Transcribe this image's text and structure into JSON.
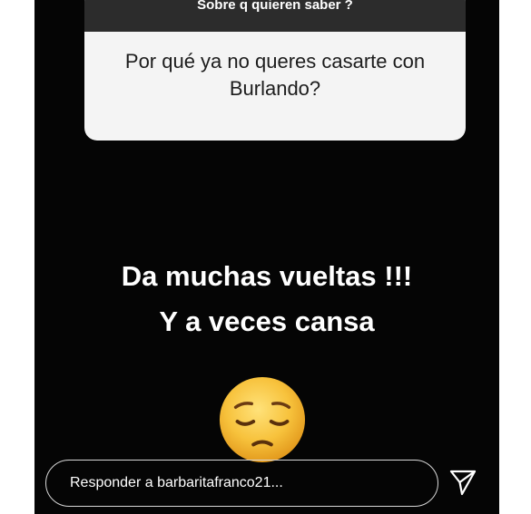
{
  "question": {
    "header": "Sobre q quieren saber ?",
    "text": "Por qué ya no queres casarte con Burlando?"
  },
  "answer": {
    "line1": "Da muchas vueltas !!!",
    "line2": "Y a veces cansa"
  },
  "sticker": {
    "emoji_icon": "pensive-face-icon"
  },
  "reply": {
    "placeholder": "Responder a barbaritafranco21..."
  },
  "colors": {
    "story_background": "#050505",
    "question_header": "#2c2c2c",
    "question_body": "#f4f4f4",
    "text_white": "#ffffff"
  }
}
